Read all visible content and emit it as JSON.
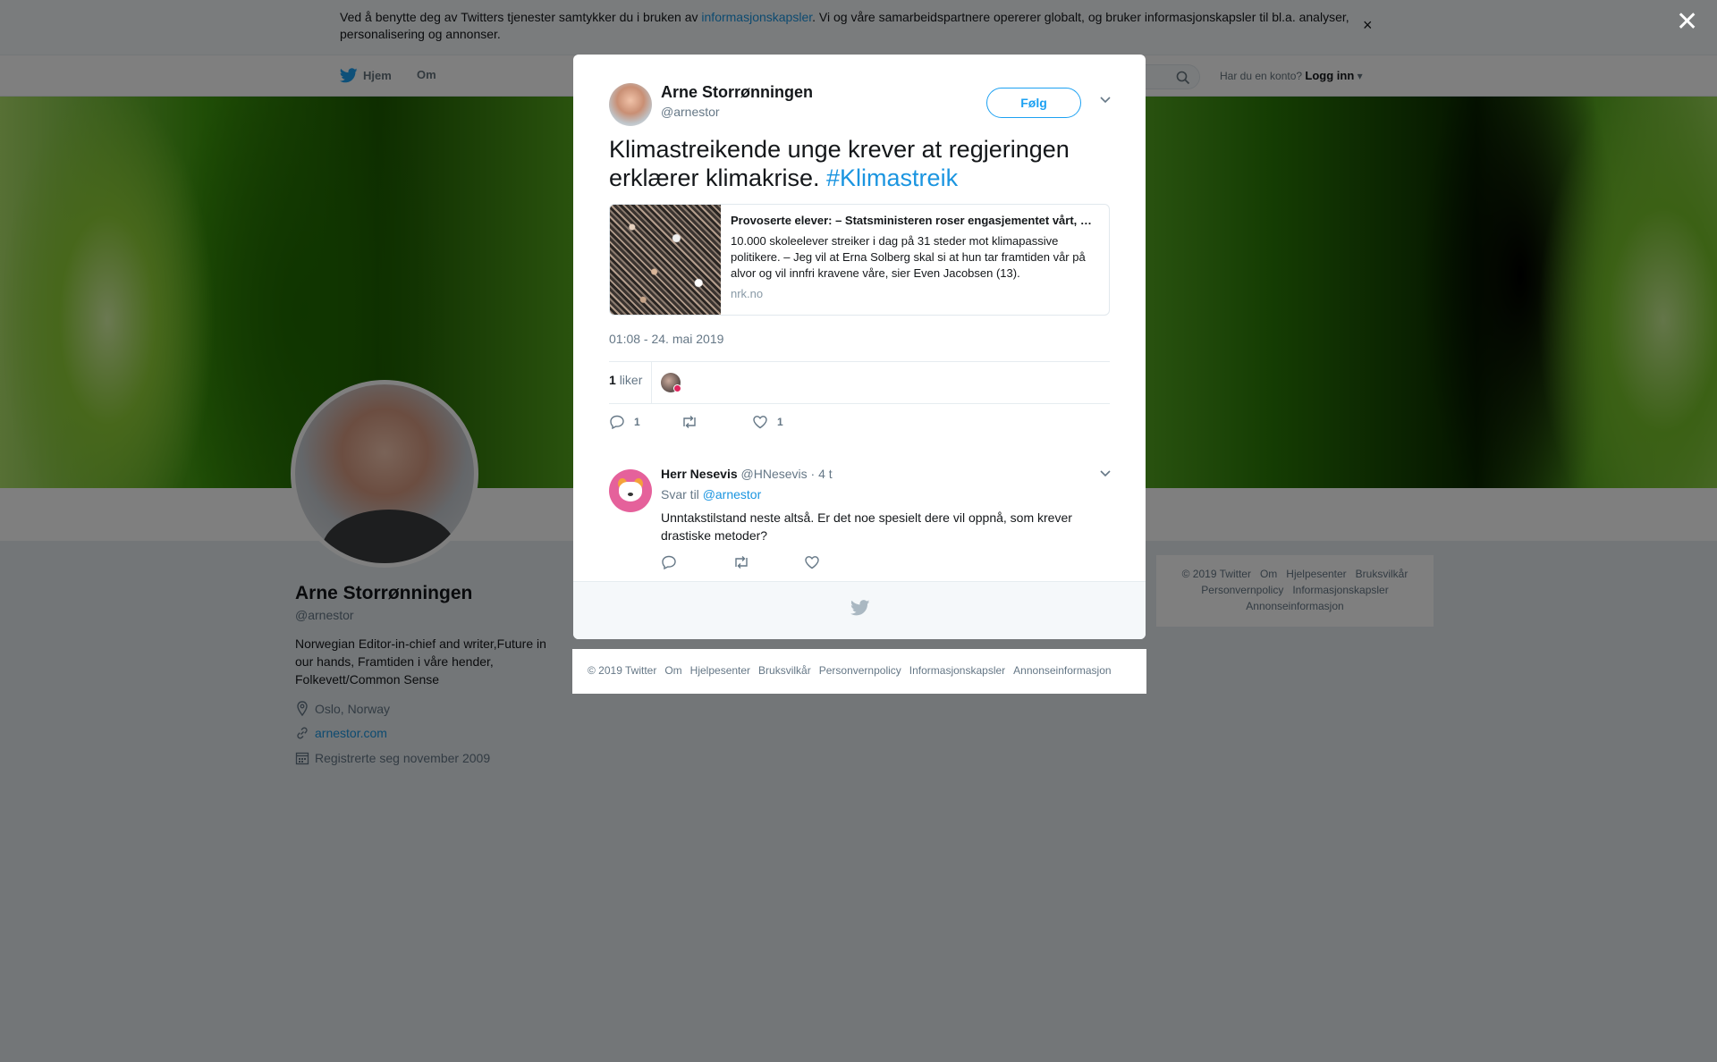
{
  "cookie": {
    "prefix": "Ved å benytte deg av Twitters tjenester samtykker du i bruken av ",
    "link": "informasjonskapsler",
    "suffix": ". Vi og våre samarbeidspartnere opererer globalt, og bruker informasjonskapsler til bl.a. analyser, personalisering og annonser.",
    "close": "×"
  },
  "nav": {
    "home": "Hjem",
    "about": "Om",
    "login_prompt": "Har du en konto?",
    "login": "Logg inn"
  },
  "profile": {
    "name": "Arne Storrønningen",
    "handle": "@arnestor",
    "bio": "Norwegian Editor-in-chief and writer,Future in our hands, Framtiden i våre hender, Folkevett/Common Sense",
    "location": "Oslo, Norway",
    "website": "arnestor.com",
    "joined": "Registrerte seg november 2009"
  },
  "side_footer": [
    "© 2019 Twitter",
    "Om",
    "Hjelpesenter",
    "Bruksvilkår",
    "Personvernpolicy",
    "Informasjonskapsler",
    "Annonseinformasjon"
  ],
  "overlay_close": "✕",
  "tweet": {
    "name": "Arne Storrønningen",
    "handle": "@arnestor",
    "follow": "Følg",
    "text": "Klimastreikende unge krever at regjeringen erklærer klimakrise. ",
    "hashtag": "#Klimastreik",
    "card": {
      "title": "Provoserte elever: – Statsministeren roser engasjementet vårt, men gjør ingenting",
      "description": "10.000 skoleelever streiker i dag på 31 steder mot klimapassive politikere. – Jeg vil at Erna Solberg skal si at hun tar framtiden vår på alvor og vil innfri kravene våre, sier Even Jacobsen (13).",
      "domain": "nrk.no"
    },
    "timestamp": "01:08 - 24. mai 2019",
    "likes_count": "1",
    "likes_label": "liker",
    "reply_count": "1",
    "retweet_count": "",
    "like_count": "1"
  },
  "reply": {
    "name": "Herr Nesevis",
    "handle": "@HNesevis",
    "time": "· 4 t",
    "reply_to_label": "Svar til ",
    "reply_to": "@arnestor",
    "text": "Unntakstilstand neste altså. Er det noe spesielt dere vil oppnå, som krever drastiske metoder?"
  },
  "modal_footer": [
    "© 2019 Twitter",
    "Om",
    "Hjelpesenter",
    "Bruksvilkår",
    "Personvernpolicy",
    "Informasjonskapsler",
    "Annonseinformasjon"
  ],
  "colors": {
    "accent": "#1da1f2",
    "link": "#1b95e0",
    "like": "#e0245e"
  }
}
